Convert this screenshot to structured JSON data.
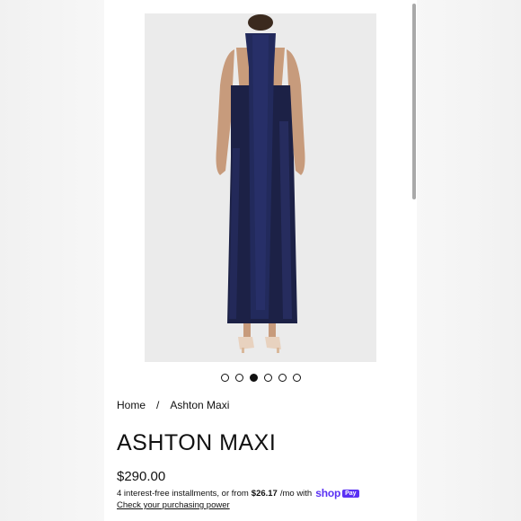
{
  "carousel": {
    "slide_count": 6,
    "active_index": 2
  },
  "breadcrumb": {
    "home": "Home",
    "separator": "/",
    "current": "Ashton Maxi"
  },
  "product": {
    "title": "ASHTON MAXI",
    "price": "$290.00",
    "installment_prefix": "4 interest-free installments, or from",
    "installment_amount": "$26.17",
    "installment_suffix": "/mo with",
    "shop_brand": "shop",
    "shop_pay_badge": "Pay",
    "check_link": "Check your purchasing power"
  },
  "colors": {
    "accent": "#5a31f4",
    "dress": "#1c2146",
    "photo_bg": "#ebebeb"
  },
  "icons": [
    "carousel-dot-icon",
    "shop-pay-logo"
  ]
}
